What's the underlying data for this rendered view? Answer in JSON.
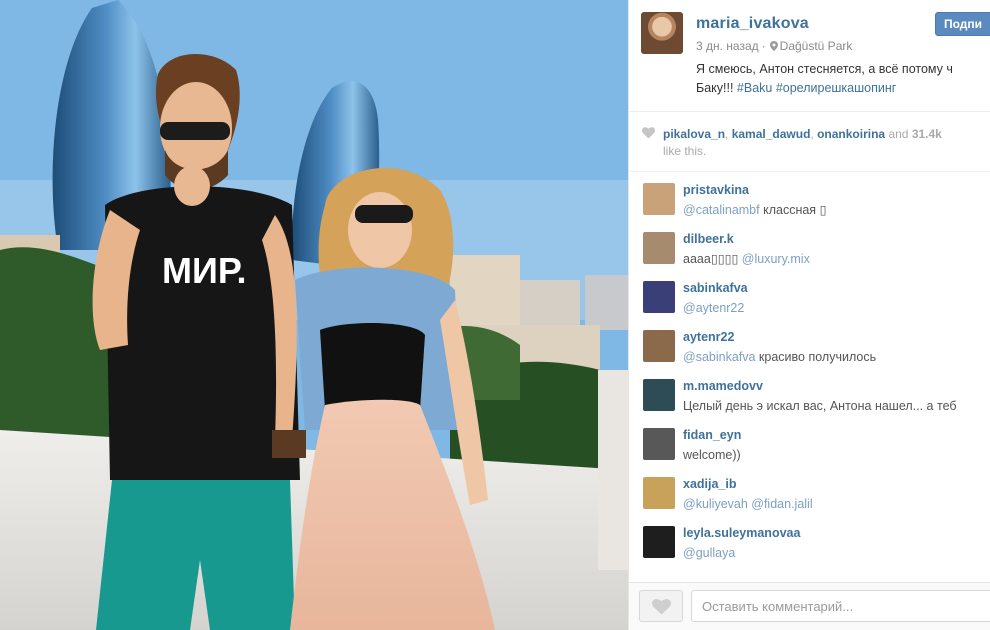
{
  "post": {
    "username": "maria_ivakova",
    "time_ago": "3 дн. назад",
    "location": "Dağüstü Park",
    "follow_label": "Подпи",
    "caption_line1": "Я смеюсь, Антон стесняется, а всё потому ч",
    "caption_line2_text": "Баку!!! ",
    "caption_tags": "#Baku #орелирешкашопинг"
  },
  "likes": {
    "users": [
      "pikalova_n",
      "kamal_dawud",
      "onankoirina"
    ],
    "and_text": "and",
    "count": "31.4k",
    "tail": "like this."
  },
  "comments": [
    {
      "user": "pristavkina",
      "mention": "@catalinambf",
      "text": " классная ",
      "emoji": "▯",
      "avatar": "#c9a27a"
    },
    {
      "user": "dilbeer.k",
      "prefix": "аааа",
      "emoji": "▯▯▯▯",
      "mention": " @luxury.mix",
      "avatar": "#a78b6e"
    },
    {
      "user": "sabinkafva",
      "mention": "@aytenr22",
      "avatar": "#3b3f77"
    },
    {
      "user": "aytenr22",
      "mention": "@sabinkafva",
      "text": " красиво получилось",
      "avatar": "#8a6a4a"
    },
    {
      "user": "m.mamedovv",
      "text": "Целый день э искал вас, Антона нашел... а теб",
      "avatar": "#2d4c56"
    },
    {
      "user": "fidan_eyn",
      "text": "welcome))",
      "avatar": "#585858"
    },
    {
      "user": "xadija_ib",
      "mention": "@kuliyevah @fidan.jalil",
      "avatar": "#c8a15a"
    },
    {
      "user": "leyla.suleymanovaa",
      "mention": "@gullaya",
      "avatar": "#1e1e1e"
    }
  ],
  "comment_field": {
    "placeholder": "Оставить комментарий..."
  },
  "shirt_text": "МИР.",
  "colors": {
    "link": "#3f729b",
    "mention": "#7da0c2",
    "follow_button": "#5a8ac0",
    "muted_text": "#8a8a8a"
  }
}
